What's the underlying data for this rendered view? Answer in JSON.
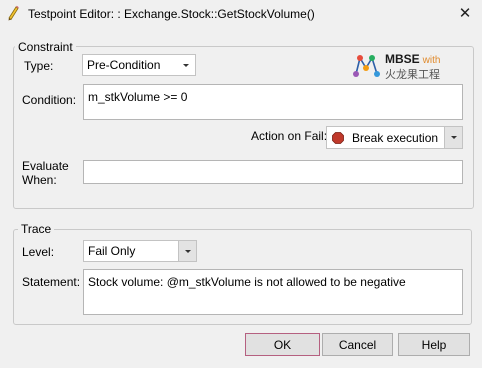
{
  "window": {
    "title": "Testpoint Editor: : Exchange.Stock::GetStockVolume()",
    "close_glyph": "✕"
  },
  "constraint": {
    "group_label": "Constraint",
    "type_label": "Type:",
    "type_value": "Pre-Condition",
    "condition_label": "Condition:",
    "condition_value": "m_stkVolume >= 0",
    "action_label": "Action on Fail:",
    "action_value": "Break execution",
    "evaluate_label_line1": "Evaluate",
    "evaluate_label_line2": "When:",
    "evaluate_value": ""
  },
  "logo": {
    "line1": "MBSE",
    "line1_suffix": "with",
    "line2": "火龙果工程"
  },
  "trace": {
    "group_label": "Trace",
    "level_label": "Level:",
    "level_value": "Fail Only",
    "statement_label": "Statement:",
    "statement_value": "Stock volume: @m_stkVolume is not allowed to be negative"
  },
  "buttons": {
    "ok": "OK",
    "cancel": "Cancel",
    "help": "Help"
  },
  "icons": {
    "title": "pencil-icon",
    "action": "stop-icon"
  },
  "colors": {
    "background": "#f0f0f0",
    "ok_border": "#b56080",
    "stop_icon": "#c0392b",
    "logo_accent": "#e08a2c"
  }
}
